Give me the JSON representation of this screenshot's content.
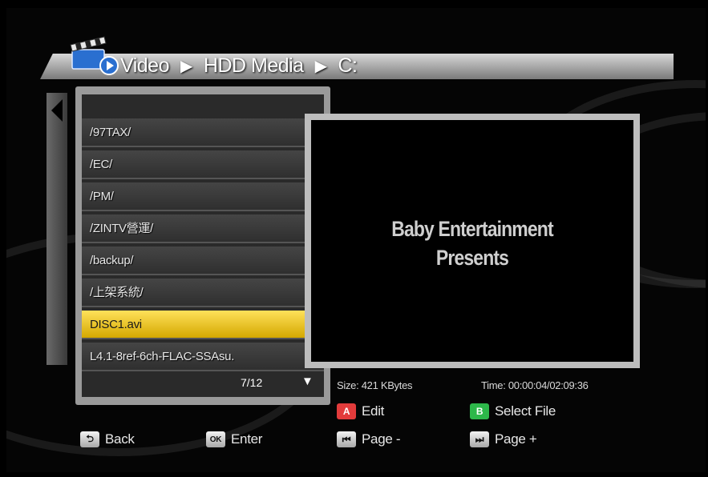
{
  "breadcrumb": {
    "root": "Video",
    "sep1": "▶",
    "level1": "HDD Media",
    "sep2": "▶",
    "level2": "C:"
  },
  "file_list": {
    "items": [
      {
        "label": "/97TAX/"
      },
      {
        "label": "/EC/"
      },
      {
        "label": "/PM/"
      },
      {
        "label": "/ZINTV營運/"
      },
      {
        "label": "/backup/"
      },
      {
        "label": "/上架系統/"
      },
      {
        "label": "DISC1.avi",
        "selected": true
      },
      {
        "label": "L4.1-8ref-6ch-FLAC-SSAsu."
      }
    ],
    "pager": "7/12",
    "more_indicator": "▼"
  },
  "preview": {
    "line1": "Baby Entertainment",
    "line2": "Presents"
  },
  "info": {
    "size_label": "Size:",
    "size_value": "421 KBytes",
    "time_label": "Time:",
    "time_value": "00:00:04/02:09:36"
  },
  "legend": {
    "edit": {
      "key": "A",
      "label": "Edit"
    },
    "select_file": {
      "key": "B",
      "label": "Select File"
    },
    "back": {
      "key": "⮌",
      "label": "Back"
    },
    "enter": {
      "key": "OK",
      "label": "Enter"
    },
    "page_prev": {
      "key": "⏮",
      "label": "Page -"
    },
    "page_next": {
      "key": "⏭",
      "label": "Page +"
    }
  },
  "colors": {
    "selected_row": "#f0c419",
    "key_a": "#e23b3b",
    "key_b": "#2db84a"
  }
}
